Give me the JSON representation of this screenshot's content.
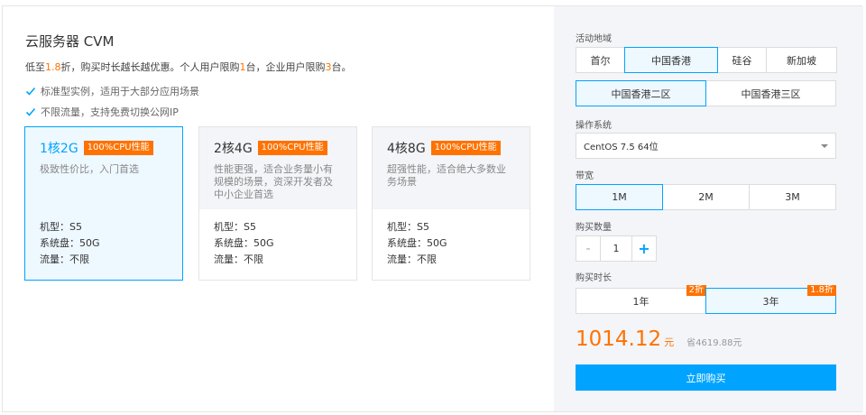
{
  "product": {
    "title": "云服务器 CVM",
    "subtitle": {
      "p1": "低至",
      "discount": "1.8",
      "p2": "折，购买时长越长越优惠。个人用户限购",
      "personal_limit": "1",
      "p3": "台，企业用户限购",
      "enterprise_limit": "3",
      "p4": "台。"
    },
    "features": [
      "标准型实例，适用于大部分应用场景",
      "不限流量，支持免费切换公网IP"
    ]
  },
  "cards": [
    {
      "name": "1核2G",
      "badge": "100%CPU性能",
      "desc": "极致性价比，入门首选",
      "model": "机型：S5",
      "disk": "系统盘：50G",
      "traffic": "流量：不限",
      "selected": true
    },
    {
      "name": "2核4G",
      "badge": "100%CPU性能",
      "desc": "性能更强，适合业务量小有规模的场景，资深开发者及中小企业首选",
      "model": "机型：S5",
      "disk": "系统盘：50G",
      "traffic": "流量：不限",
      "selected": false
    },
    {
      "name": "4核8G",
      "badge": "100%CPU性能",
      "desc": "超强性能，适合绝大多数业务场景",
      "model": "机型：S5",
      "disk": "系统盘：50G",
      "traffic": "流量：不限",
      "selected": false
    }
  ],
  "config": {
    "region_label": "活动地域",
    "regions": [
      "首尔",
      "中国香港",
      "硅谷",
      "新加坡"
    ],
    "selected_region": "中国香港",
    "zones": [
      "中国香港二区",
      "中国香港三区"
    ],
    "selected_zone": "中国香港二区",
    "os_label": "操作系统",
    "os_value": "CentOS 7.5 64位",
    "bandwidth_label": "带宽",
    "bandwidths": [
      "1M",
      "2M",
      "3M"
    ],
    "selected_bandwidth": "1M",
    "quantity_label": "购买数量",
    "quantity_minus": "-",
    "quantity": "1",
    "quantity_plus": "+",
    "duration_label": "购买时长",
    "durations": [
      {
        "label": "1年",
        "discount": "2折"
      },
      {
        "label": "3年",
        "discount": "1.8折"
      }
    ],
    "selected_duration": "3年",
    "price": "1014.12",
    "price_unit": "元",
    "saving": "省4619.88元",
    "buy_label": "立即购买"
  },
  "colors": {
    "accent": "#00a4ff",
    "orange": "#ff7200",
    "panel": "#f3f5f8"
  }
}
